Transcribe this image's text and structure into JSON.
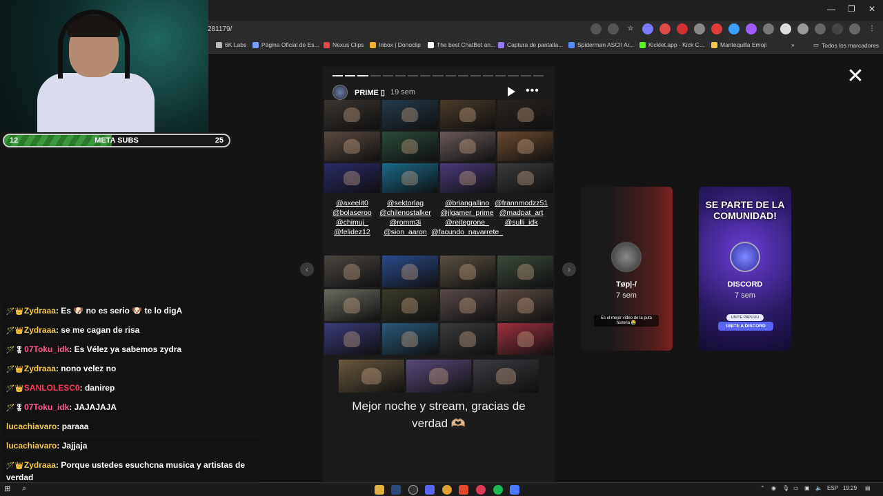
{
  "browser": {
    "url": "281179/",
    "bookmarks": [
      {
        "label": "6K Labs",
        "color": "#bbbbbb"
      },
      {
        "label": "Página Oficial de Es...",
        "color": "#7a9cff"
      },
      {
        "label": "Nexus Clips",
        "color": "#e04a4a"
      },
      {
        "label": "Inbox | Donoclip",
        "color": "#f0b030"
      },
      {
        "label": "The best ChatBot an...",
        "color": "#ffffff"
      },
      {
        "label": "Captura de pantalla...",
        "color": "#9a7aff"
      },
      {
        "label": "Spiderman ASCII Ar...",
        "color": "#5a8aff"
      },
      {
        "label": "Kicklet.app - Kick C...",
        "color": "#53fc18"
      },
      {
        "label": "Mantequilla Emoji",
        "color": "#f2c94c"
      }
    ],
    "more_bookmarks_icon": "chevron-double-right-icon",
    "all_bookmarks": "Todos los marcadores"
  },
  "stream_overlay": {
    "subs_current": "12",
    "subs_label": "META SUBS",
    "subs_goal": "25",
    "subs_progress": 0.48
  },
  "story": {
    "username": "PRIME ▯",
    "time": "19 sem",
    "segments_total": 17,
    "segments_done": 3,
    "tags_col1": [
      "@axeelit0",
      "@bolaseroo",
      "@chimuj_",
      "@felidez12"
    ],
    "tags_col2": [
      "@sektorlag",
      "@chilenostalker",
      "@romm3i",
      "@sion_aaron"
    ],
    "tags_col3": [
      "@briangallino",
      "@jlgamer_prime",
      "@reitegrone_",
      "@facundo_navarrete_"
    ],
    "tags_col4": [
      "@frannmodzz51",
      "@madpat_art",
      "@sulli_idk"
    ],
    "caption": "Mejor noche y stream, gracias de verdad 🫶🏼",
    "grid_top_colors": [
      "#3a3530",
      "#243a4a",
      "#4a3a2a",
      "#2a2420",
      "#5a4a40",
      "#2a4a3a",
      "#6a5a5a",
      "#6a4a30",
      "#2a2a6a",
      "#1a6a8a",
      "#4a3a7a",
      "#3a3a3a"
    ],
    "grid_bottom_colors": [
      "#4a4540",
      "#2a4a8a",
      "#5a5040",
      "#3a4a3a",
      "#6a6a60",
      "#3a3a2a",
      "#5a4a4a",
      "#5a4a40",
      "#3a3a7a",
      "#2a5a7a",
      "#3a3a3a",
      "#a03040"
    ],
    "grid_last_colors": [
      "#6a5a40",
      "#5a4a7a",
      "#3a3a40"
    ]
  },
  "side_stories": [
    {
      "name": "Tøp|-/",
      "time": "7 sem",
      "note": "Es el mejor video de la puta historia 😭"
    },
    {
      "name": "DISCORD",
      "time": "7 sem",
      "banner": "SE PARTE DE LA COMUNIDAD!",
      "btn_small": "UNITE PAPUUU",
      "btn_main": "UNITE A DISCORD"
    }
  ],
  "chat": [
    {
      "badges": "🪄👑",
      "user": "Zydraaa",
      "color": "#f2c94c",
      "text": "Es 🐶 no es serio 🐶 te lo digA"
    },
    {
      "badges": "🪄👑",
      "user": "Zydraaa",
      "color": "#f2c94c",
      "text": "se me cagan de risa"
    },
    {
      "badges": "🪄🎖",
      "user": "07Toku_idk",
      "color": "#ff5a8a",
      "text": "Es Vélez ya sabemos zydra"
    },
    {
      "badges": "🪄👑",
      "user": "Zydraaa",
      "color": "#f2c94c",
      "text": "nono velez no"
    },
    {
      "badges": "🪄👑",
      "user": "SANLOLESC0",
      "color": "#ff3a5a",
      "text": "danirep"
    },
    {
      "badges": "🪄🎖",
      "user": "07Toku_idk",
      "color": "#ff5a8a",
      "text": "JAJAJAJA"
    },
    {
      "badges": "",
      "user": "lucachiavaro",
      "color": "#f2c94c",
      "text": "paraaa"
    },
    {
      "badges": "",
      "user": "lucachiavaro",
      "color": "#f2c94c",
      "text": "Jajjaja"
    },
    {
      "badges": "🪄👑",
      "user": "Zydraaa",
      "color": "#f2c94c",
      "text": "Porque ustedes esuchcna musica y artistas de verdad"
    }
  ],
  "taskbar": {
    "lang": "ESP",
    "time": "19:29"
  }
}
